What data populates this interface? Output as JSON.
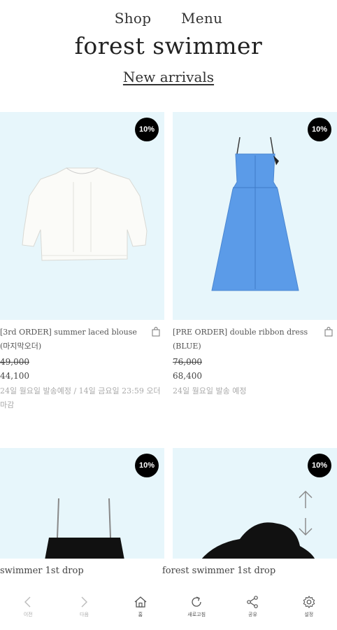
{
  "header": {
    "nav_shop": "Shop",
    "nav_menu": "Menu",
    "brand": "forest swimmer",
    "section_title": "New arrivals"
  },
  "products": [
    {
      "badge": "10%",
      "name": "[3rd ORDER] summer laced blouse (마지막오더)",
      "original_price": "49,000",
      "sale_price": "44,100",
      "note": "24일 월요일 발송예정 / 14일 금요일 23:59 오더 마감"
    },
    {
      "badge": "10%",
      "name": "[PRE ORDER] double ribbon dress (BLUE)",
      "original_price": "76,000",
      "sale_price": "68,400",
      "note": "24일 월요일 발송 예정"
    },
    {
      "badge": "10%"
    },
    {
      "badge": "10%"
    }
  ],
  "marquee": {
    "left_text": "swimmer 1st drop",
    "right_text": "forest swimmer 1st drop"
  },
  "toolbar": {
    "prev": "이전",
    "next": "다음",
    "home": "홈",
    "refresh": "새로고침",
    "share": "공유",
    "settings": "설정"
  },
  "colors": {
    "image_bg": "#e7f6fb",
    "badge_bg": "#000000",
    "dress_blue": "#5b9be8"
  }
}
